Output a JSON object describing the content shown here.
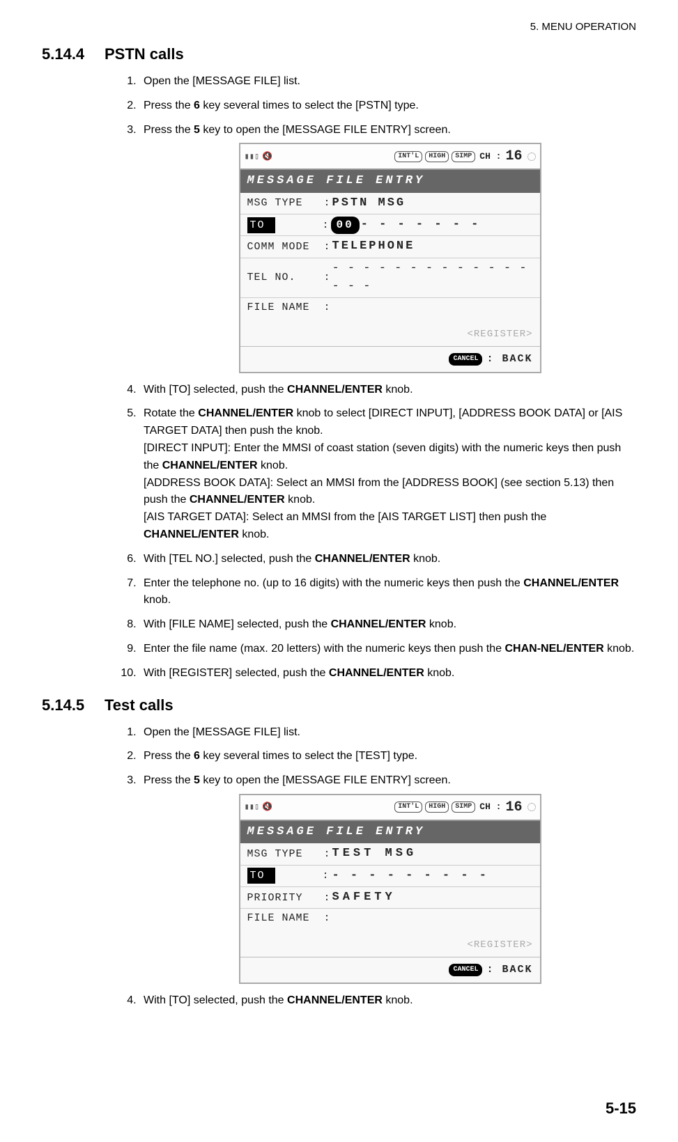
{
  "header": {
    "chapter": "5.  MENU OPERATION"
  },
  "section_a": {
    "number": "5.14.4",
    "title": "PSTN calls",
    "steps": {
      "s1": "Open the [MESSAGE FILE] list.",
      "s2a": "Press the ",
      "s2b": "6",
      "s2c": " key several times to select the [PSTN] type.",
      "s3a": "Press the ",
      "s3b": "5",
      "s3c": " key to open the [MESSAGE FILE ENTRY] screen.",
      "s4a": "With [TO] selected, push the ",
      "s4b": "CHANNEL/ENTER",
      "s4c": " knob.",
      "s5a": "Rotate the ",
      "s5b": "CHANNEL/ENTER",
      "s5c": " knob to select [DIRECT INPUT], [ADDRESS BOOK DATA] or [AIS TARGET DATA] then push the knob.",
      "s5d": "[DIRECT INPUT]: Enter the MMSI of coast station (seven digits) with the numeric keys then push the ",
      "s5e": "CHANNEL/ENTER",
      "s5f": " knob.",
      "s5g": "[ADDRESS BOOK DATA]: Select an MMSI from the [ADDRESS BOOK] (see section 5.13) then push the ",
      "s5h": "CHANNEL/ENTER",
      "s5i": " knob.",
      "s5j": "[AIS TARGET DATA]: Select an MMSI from the [AIS TARGET LIST] then push the ",
      "s5k": "CHANNEL/ENTER",
      "s5l": " knob.",
      "s6a": "With [TEL NO.] selected, push the ",
      "s6b": "CHANNEL/ENTER",
      "s6c": " knob.",
      "s7a": "Enter the telephone no. (up to 16 digits) with the numeric keys then push the ",
      "s7b": "CHANNEL/ENTER",
      "s7c": " knob.",
      "s8a": "With [FILE NAME] selected, push the ",
      "s8b": "CHANNEL/ENTER",
      "s8c": " knob.",
      "s9a": "Enter the file name (max. 20 letters) with the numeric keys then push the ",
      "s9b": "CHAN-NEL/ENTER",
      "s9c": " knob.",
      "s10a": "With [REGISTER] selected, push the ",
      "s10b": "CHANNEL/ENTER",
      "s10c": " knob."
    }
  },
  "screen_a": {
    "status": {
      "pill1": "INT'L",
      "pill2": "HIGH",
      "pill3": "SIMP",
      "ch_label": "CH :",
      "ch_num": "16"
    },
    "title": "MESSAGE FILE ENTRY",
    "rows": {
      "msg_type": {
        "label": "MSG TYPE",
        "value": "PSTN MSG"
      },
      "to": {
        "label": "TO",
        "value_pill": "00",
        "value_dash": "- - - - - - -"
      },
      "comm": {
        "label": "COMM MODE",
        "value": "TELEPHONE"
      },
      "tel": {
        "label": "TEL NO.",
        "value": "- - - - - - - - - - - - - - - -"
      },
      "file": {
        "label": "FILE NAME",
        "value": ""
      }
    },
    "register": "<REGISTER>",
    "footer": {
      "cancel": "CANCEL",
      "back": ": BACK"
    }
  },
  "section_b": {
    "number": "5.14.5",
    "title": "Test calls",
    "steps": {
      "s1": "Open the [MESSAGE FILE] list.",
      "s2a": "Press the ",
      "s2b": "6",
      "s2c": " key several times to select the [TEST] type.",
      "s3a": "Press the ",
      "s3b": "5",
      "s3c": " key to open the [MESSAGE FILE ENTRY] screen.",
      "s4a": "With [TO] selected, push the ",
      "s4b": "CHANNEL/ENTER",
      "s4c": " knob."
    }
  },
  "screen_b": {
    "status": {
      "pill1": "INT'L",
      "pill2": "HIGH",
      "pill3": "SIMP",
      "ch_label": "CH :",
      "ch_num": "16"
    },
    "title": "MESSAGE FILE ENTRY",
    "rows": {
      "msg_type": {
        "label": "MSG TYPE",
        "value": "TEST MSG"
      },
      "to": {
        "label": "TO",
        "value_dash": "- - - - - - - - -"
      },
      "priority": {
        "label": "PRIORITY",
        "value": "SAFETY"
      },
      "file": {
        "label": "FILE NAME",
        "value": ""
      }
    },
    "register": "<REGISTER>",
    "footer": {
      "cancel": "CANCEL",
      "back": ": BACK"
    }
  },
  "page_footer": "5-15"
}
